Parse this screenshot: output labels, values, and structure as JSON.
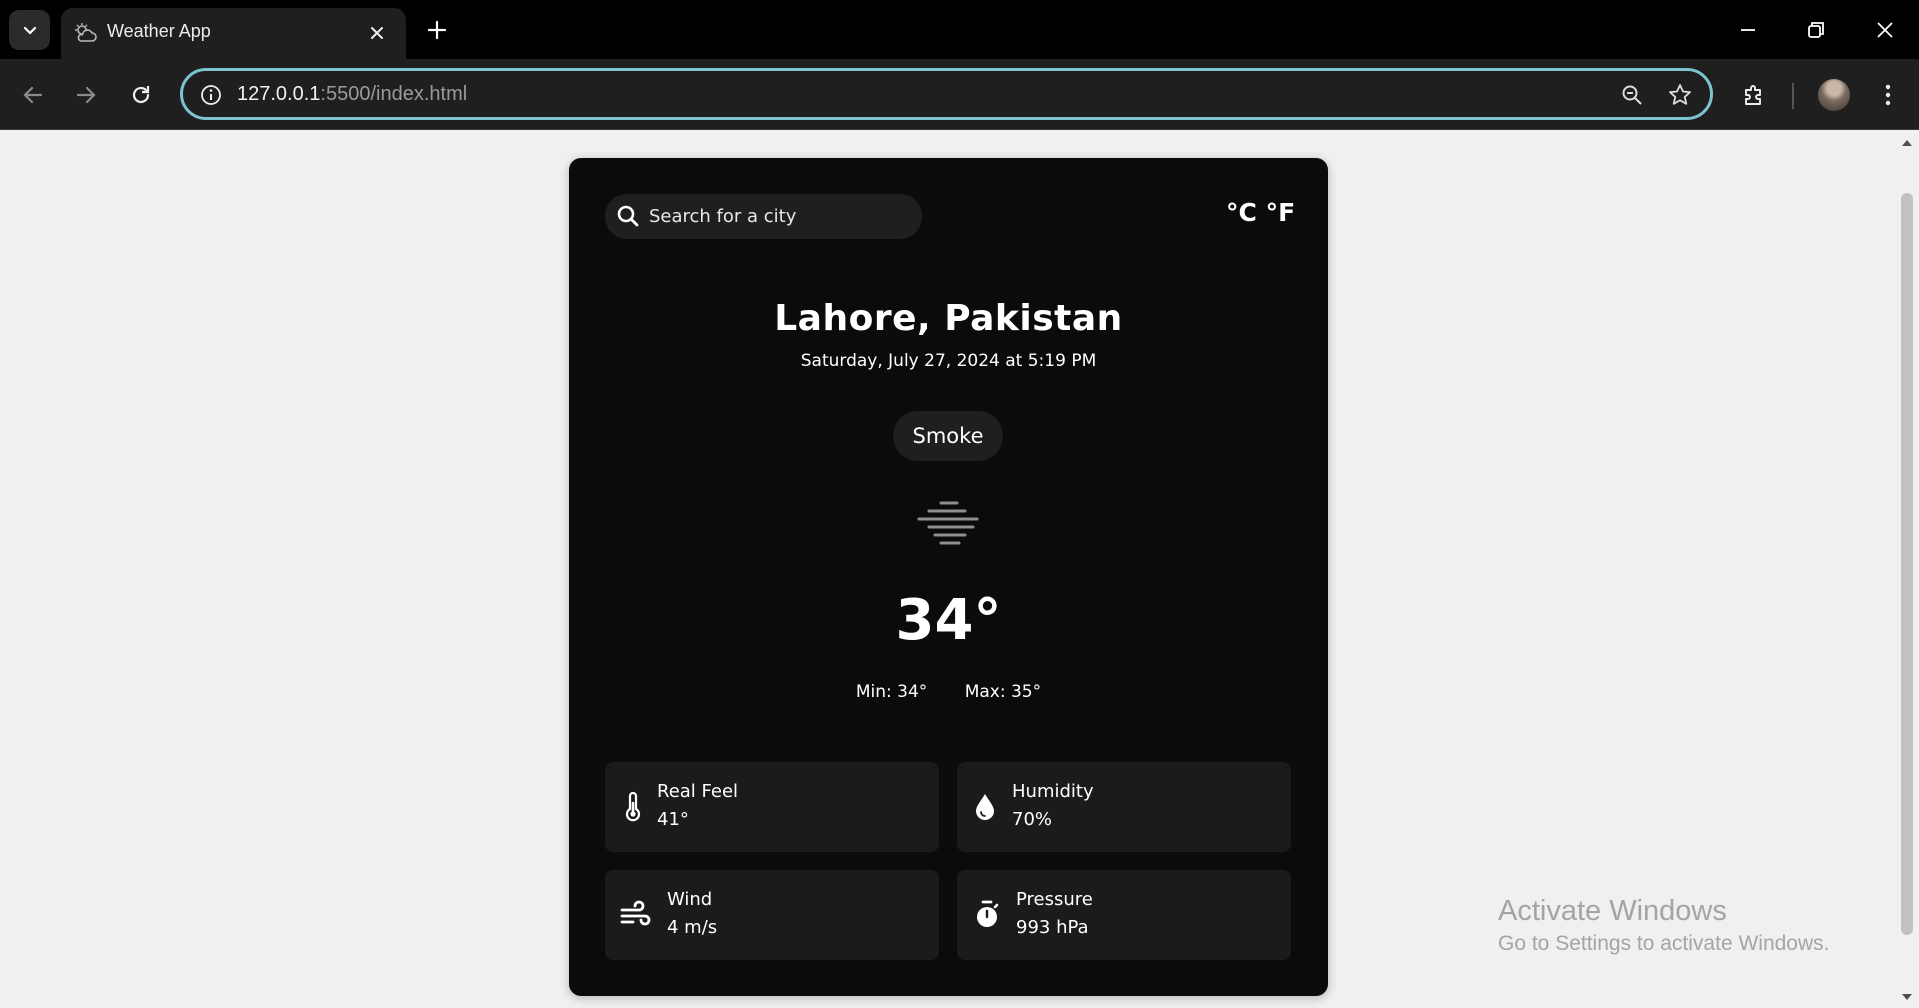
{
  "browser": {
    "tab_title": "Weather App",
    "url_host": "127.0.0.1",
    "url_rest": ":5500/index.html"
  },
  "search": {
    "placeholder": "Search for a city"
  },
  "units": {
    "celsius": "°C",
    "fahrenheit": "°F"
  },
  "weather": {
    "city": "Lahore, Pakistan",
    "datetime": "Saturday, July 27, 2024 at 5:19 PM",
    "condition": "Smoke",
    "condition_icon": "haze-icon",
    "temperature": "34°",
    "min": "Min: 34°",
    "max": "Max: 35°"
  },
  "stats": {
    "real_feel": {
      "label": "Real Feel",
      "value": "41°",
      "icon": "thermometer-icon"
    },
    "humidity": {
      "label": "Humidity",
      "value": "70%",
      "icon": "droplet-icon"
    },
    "wind": {
      "label": "Wind",
      "value": "4 m/s",
      "icon": "wind-icon"
    },
    "pressure": {
      "label": "Pressure",
      "value": "993 hPa",
      "icon": "stopwatch-icon"
    }
  },
  "watermark": {
    "title": "Activate Windows",
    "subtitle": "Go to Settings to activate Windows."
  },
  "colors": {
    "card_bg": "#0b0b0b",
    "omnibox_focus": "#7cc3cf",
    "page_bg": "#f0f0f0"
  }
}
